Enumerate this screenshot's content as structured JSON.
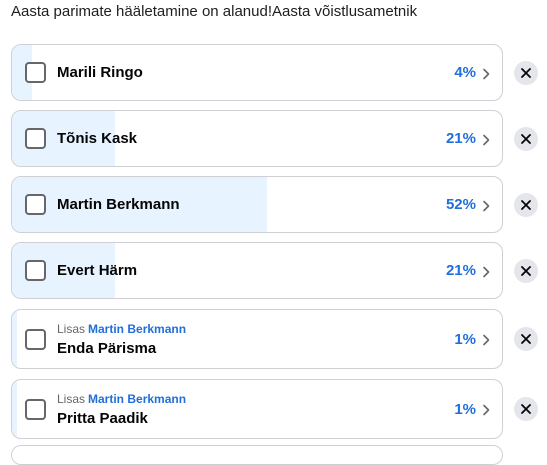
{
  "title": "Aasta parimate hääletamine on alanud!Aasta võistlusametnik",
  "added_by_prefix": "Lisas",
  "options": [
    {
      "name": "Marili Ringo",
      "percent": "4%",
      "fraction": 0.04,
      "added_by": null
    },
    {
      "name": "Tõnis Kask",
      "percent": "21%",
      "fraction": 0.21,
      "added_by": null
    },
    {
      "name": "Martin Berkmann",
      "percent": "52%",
      "fraction": 0.52,
      "added_by": null
    },
    {
      "name": "Evert Härm",
      "percent": "21%",
      "fraction": 0.21,
      "added_by": null
    },
    {
      "name": "Enda Pärisma",
      "percent": "1%",
      "fraction": 0.01,
      "added_by": "Martin Berkmann"
    },
    {
      "name": "Pritta Paadik",
      "percent": "1%",
      "fraction": 0.01,
      "added_by": "Martin Berkmann"
    }
  ],
  "icons": {
    "checkbox": "checkbox-icon",
    "chevron": "chevron-right-icon",
    "remove": "close-icon"
  },
  "colors": {
    "fill": "#e7f3ff",
    "accent": "#216fdb",
    "border": "#ced0d4",
    "remove_bg": "#e4e6eb"
  }
}
